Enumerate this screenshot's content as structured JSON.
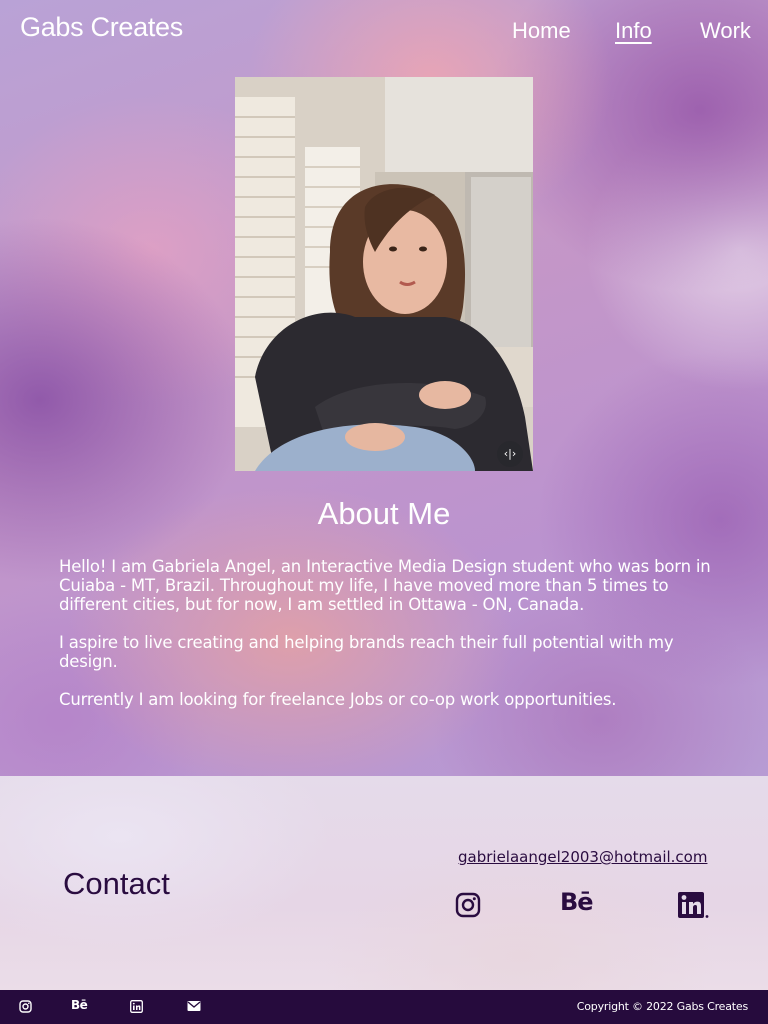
{
  "header": {
    "brand": "Gabs Creates",
    "nav": [
      {
        "label": "Home",
        "active": false
      },
      {
        "label": "Info",
        "active": true
      },
      {
        "label": "Work",
        "active": false
      }
    ]
  },
  "about": {
    "title": "About Me",
    "paragraphs": [
      "Hello! I am Gabriela Angel, an Interactive Media Design student who was born in Cuiaba - MT, Brazil. Throughout my life, I have moved more than 5 times to different cities, but for now, I am settled in Ottawa - ON, Canada.",
      "I aspire to live creating and helping brands reach their full potential with my design.",
      "Currently I am looking for freelance Jobs or co-op work opportunities."
    ],
    "image_badge_icon": "expand-arrows-icon"
  },
  "contact": {
    "title": "Contact",
    "email": "gabrielaangel2003@hotmail.com",
    "socials": [
      "instagram-icon",
      "behance-icon",
      "linkedin-icon"
    ],
    "behance_text": "Bē"
  },
  "footer": {
    "icons": [
      "instagram-icon",
      "behance-icon",
      "linkedin-icon",
      "mail-icon"
    ],
    "behance_text": "Bē",
    "copyright": "Copyright © 2022 Gabs Creates"
  },
  "colors": {
    "text_light": "#ffffff",
    "text_dark": "#2a0c40",
    "footer_bg": "#260b3d"
  }
}
